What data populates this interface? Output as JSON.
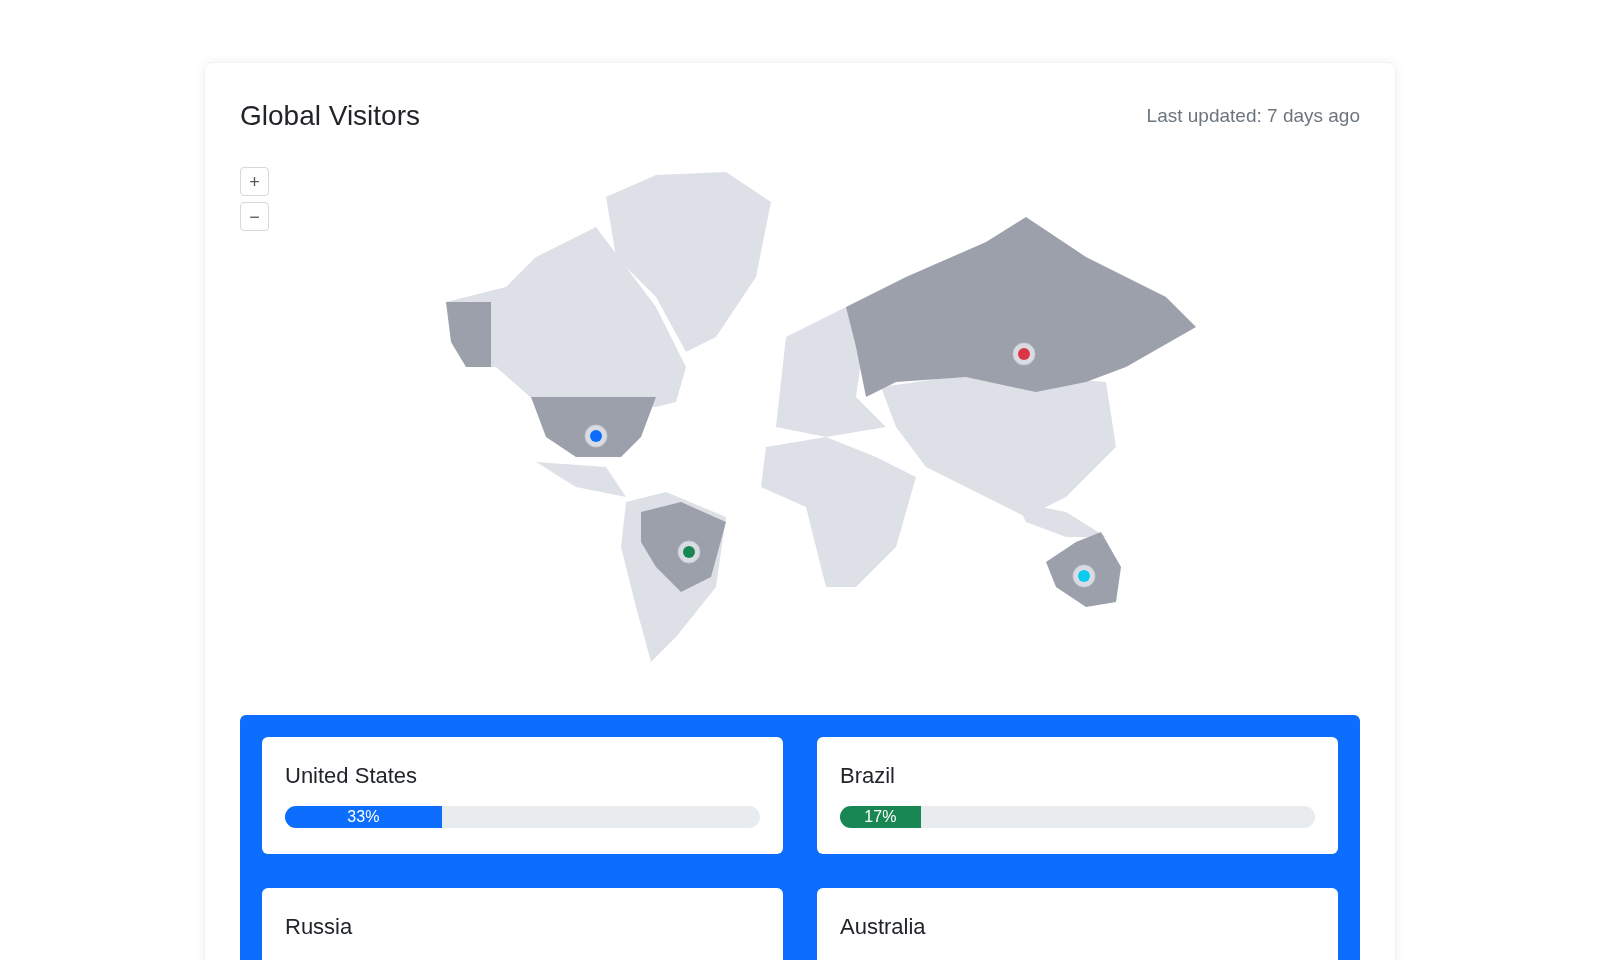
{
  "title": "Global Visitors",
  "last_updated": "Last updated: 7 days ago",
  "zoom_controls": [
    "+",
    "−"
  ],
  "map": {
    "markers": [
      {
        "color": "#0d6efd"
      },
      {
        "color": "#198754"
      },
      {
        "color": "#dc3545"
      },
      {
        "color": "#0dcaf0"
      }
    ]
  },
  "countries": [
    {
      "name": "United States",
      "progress": {
        "label": "33%",
        "level": 0.33,
        "color": "#0d6efd"
      }
    },
    {
      "name": "Brazil",
      "progress": {
        "label": "17%",
        "level": 0.17,
        "color": "#198754"
      }
    },
    {
      "name": "Russia"
    },
    {
      "name": "Australia"
    }
  ]
}
